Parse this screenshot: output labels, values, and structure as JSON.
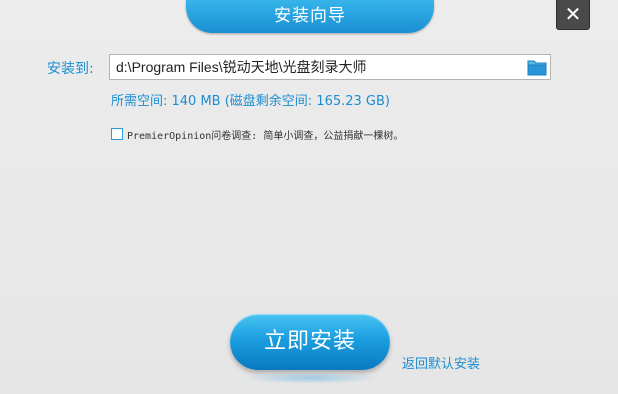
{
  "window": {
    "title": "安装向导",
    "close_glyph": "✕"
  },
  "install_path": {
    "label": "安装到:",
    "value": "d:\\Program Files\\锐动天地\\光盘刻录大师",
    "browse_icon": "folder-icon"
  },
  "space_info": {
    "text": "所需空间: 140 MB (磁盘剩余空间: 165.23 GB)"
  },
  "survey": {
    "checked": false,
    "text": "PremierOpinion问卷调查: 简单小调查，公益捐献一棵树。"
  },
  "actions": {
    "install_label": "立即安装",
    "default_link": "返回默认安装"
  },
  "colors": {
    "accent": "#1a8ed2",
    "button_top": "#49c4f2",
    "button_bottom": "#0a78c2"
  }
}
